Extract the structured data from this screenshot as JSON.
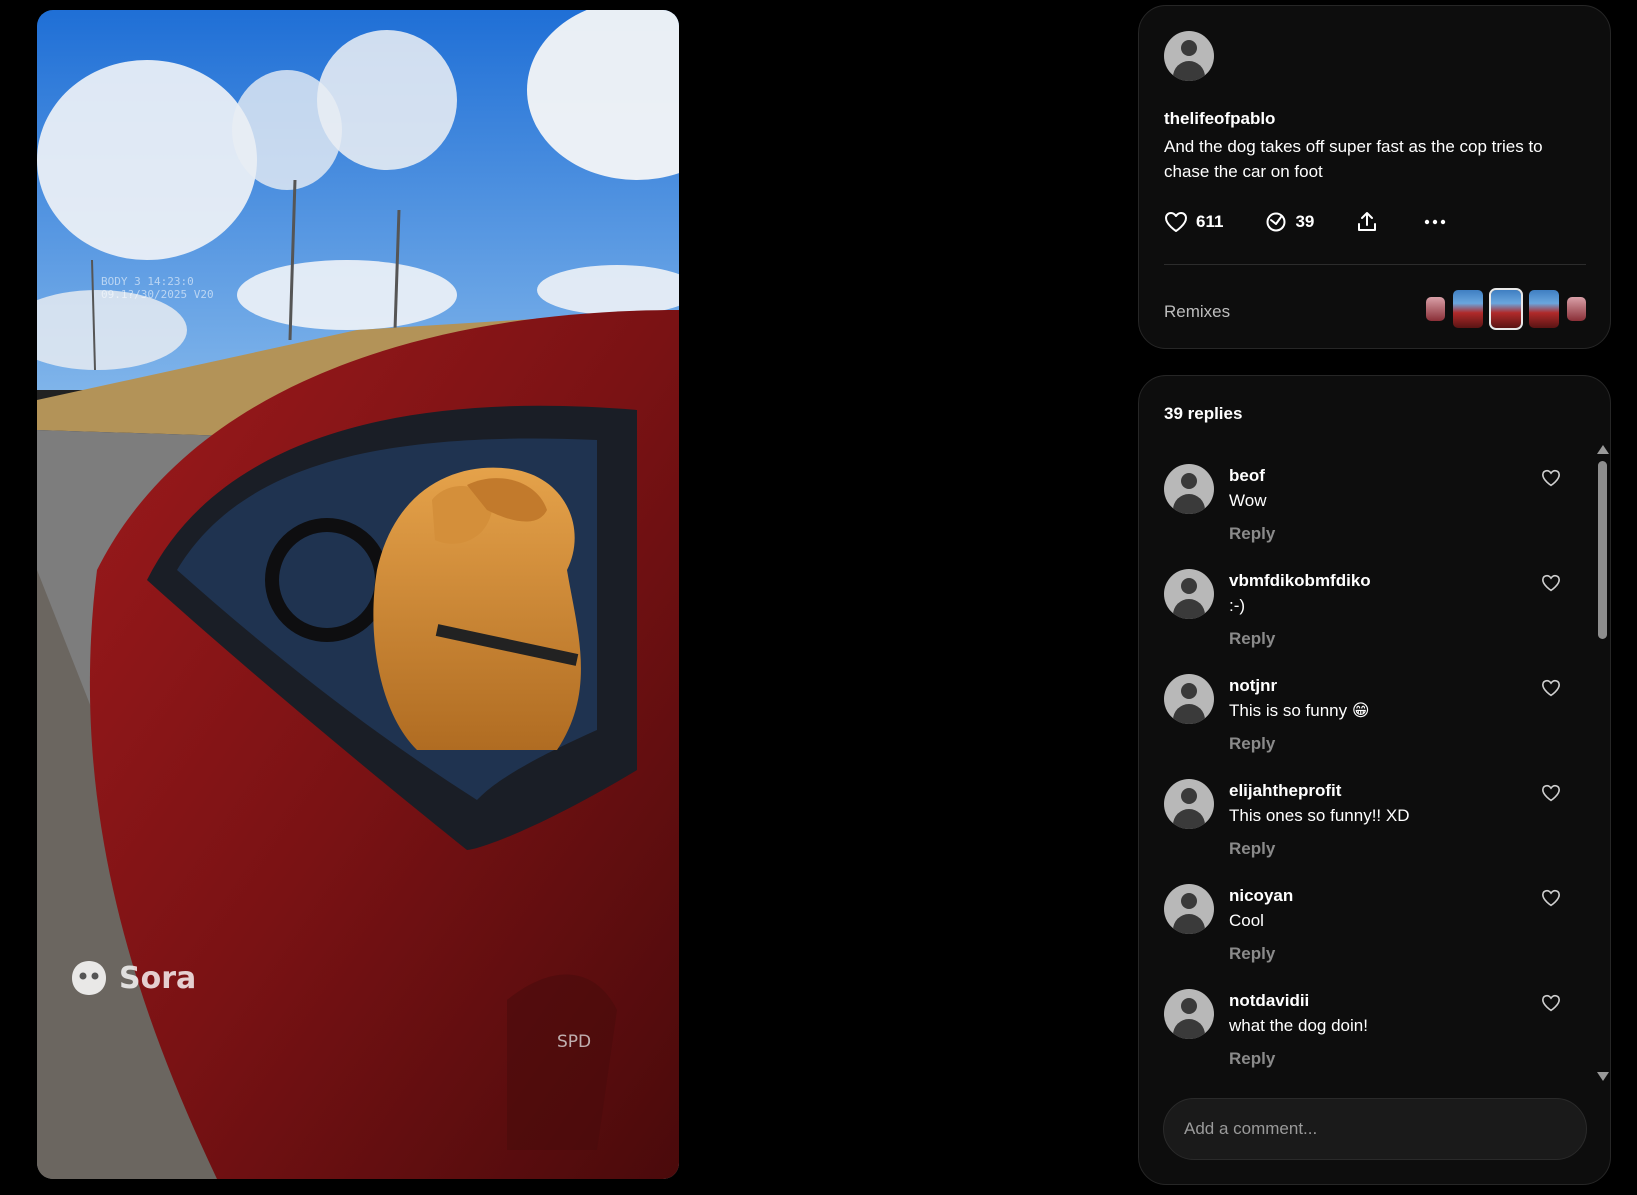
{
  "video": {
    "overlay_line1": "BODY 3 14:23:0",
    "overlay_line2": "09.1?/30/2025 V20",
    "side_text": "SPD",
    "watermark": "Sora"
  },
  "post": {
    "username": "thelifeofpablo",
    "caption": "And the dog takes off super fast as the cop tries to chase the car on foot",
    "likes": "611",
    "remixes_count": "39",
    "remixes_label": "Remixes"
  },
  "replies": {
    "title": "39 replies",
    "reply_label": "Reply",
    "items": [
      {
        "user": "beof",
        "text": "Wow"
      },
      {
        "user": "vbmfdikobmfdiko",
        "text": ":-)"
      },
      {
        "user": "notjnr",
        "text": "This is so funny 😁"
      },
      {
        "user": "elijahtheprofit",
        "text": "This ones so funny!! XD"
      },
      {
        "user": "nicoyan",
        "text": "Cool"
      },
      {
        "user": "notdavidii",
        "text": "what the dog doin!"
      }
    ]
  },
  "comment_input": {
    "placeholder": "Add a comment..."
  }
}
